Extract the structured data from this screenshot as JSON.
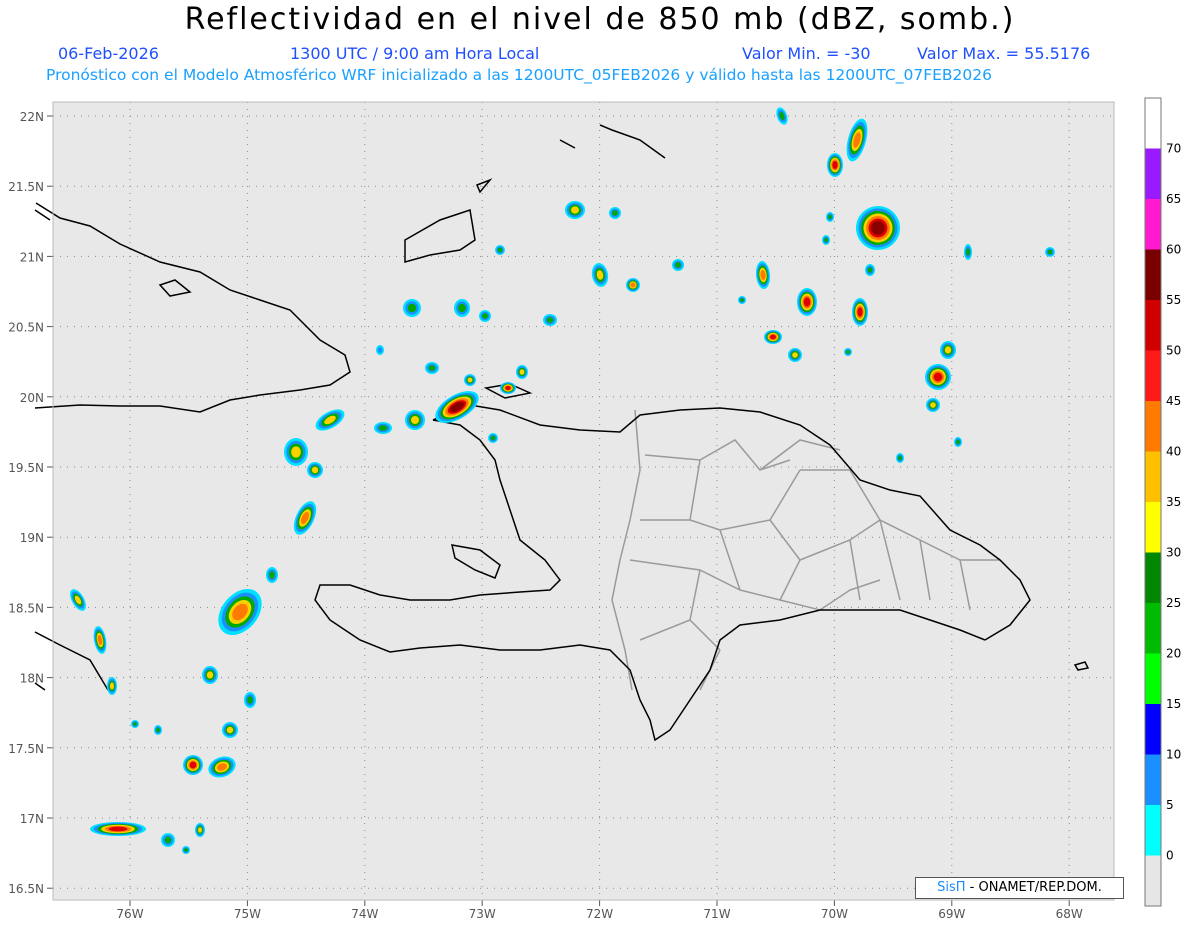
{
  "header": {
    "title": "Reflectividad en el nivel de 850 mb (dBZ, somb.)",
    "date": "06-Feb-2026",
    "time": "1300 UTC / 9:00 am Hora Local",
    "valmin": "Valor Min. = -30",
    "valmax": "Valor Max. = 55.5176",
    "model_line": "Pronóstico con el Modelo Atmosférico WRF inicializado a las 1200UTC_05FEB2026 y válido hasta las  1200UTC_07FEB2026"
  },
  "map": {
    "background": "#e8e8e8",
    "lat_labels": [
      "22N",
      "21.5N",
      "21N",
      "20.5N",
      "20N",
      "19.5N",
      "19N",
      "18.5N",
      "18N",
      "17.5N",
      "17N",
      "16.5N"
    ],
    "lon_labels": [
      "76W",
      "75W",
      "74W",
      "73W",
      "72W",
      "71W",
      "70W",
      "69W",
      "68W"
    ]
  },
  "colorbar": {
    "ticks": [
      "70",
      "65",
      "60",
      "55",
      "50",
      "45",
      "40",
      "35",
      "30",
      "25",
      "20",
      "15",
      "10",
      "5",
      "0"
    ],
    "colors": [
      "#ffffff",
      "#9a1aff",
      "#ff1ad0",
      "#7a0000",
      "#d00000",
      "#ff1a1a",
      "#ff7a00",
      "#ffc000",
      "#ffff00",
      "#008800",
      "#00bb00",
      "#00ff00",
      "#0000ff",
      "#1a90ff",
      "#00ffff",
      "#e6e6e6"
    ]
  },
  "credit": {
    "brand": "SisΠ",
    "text": "- ONAMET/REP.DOM."
  }
}
